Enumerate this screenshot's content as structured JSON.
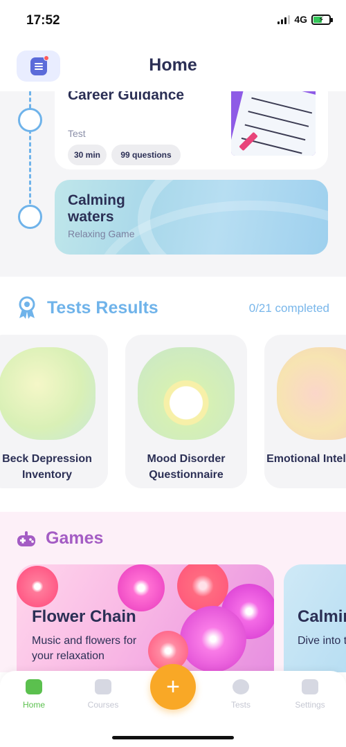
{
  "status_bar": {
    "time": "17:52",
    "network": "4G"
  },
  "header": {
    "title": "Home"
  },
  "timeline": {
    "course": {
      "title": "Career Guidance",
      "type": "Test",
      "duration": "30 min",
      "questions": "99 questions"
    },
    "game": {
      "title": "Calming waters",
      "type": "Relaxing Game"
    }
  },
  "tests_results": {
    "title": "Tests Results",
    "progress": "0/21 completed",
    "items": [
      {
        "name": "Beck Depression Inventory"
      },
      {
        "name": "Mood Disorder Questionnaire"
      },
      {
        "name": "Emotional Intelligence"
      }
    ]
  },
  "games": {
    "title": "Games",
    "items": [
      {
        "title": "Flower Chain",
        "subtitle": "Music and flowers for your relaxation"
      },
      {
        "title": "Calming waters",
        "subtitle": "Dive into tranquillity"
      }
    ]
  },
  "tabbar": {
    "items": [
      {
        "label": "Home",
        "icon": "home-icon",
        "active": true
      },
      {
        "label": "Courses",
        "icon": "courses-icon",
        "active": false
      },
      {
        "label": "Tests",
        "icon": "tests-icon",
        "active": false
      },
      {
        "label": "Settings",
        "icon": "settings-icon",
        "active": false
      }
    ],
    "add_icon": "plus-icon"
  },
  "colors": {
    "accent_blue": "#6fb3ea",
    "accent_purple": "#a45cc4",
    "accent_orange": "#f9a826",
    "accent_green": "#5bc04e",
    "text_dark": "#2b2f55"
  }
}
